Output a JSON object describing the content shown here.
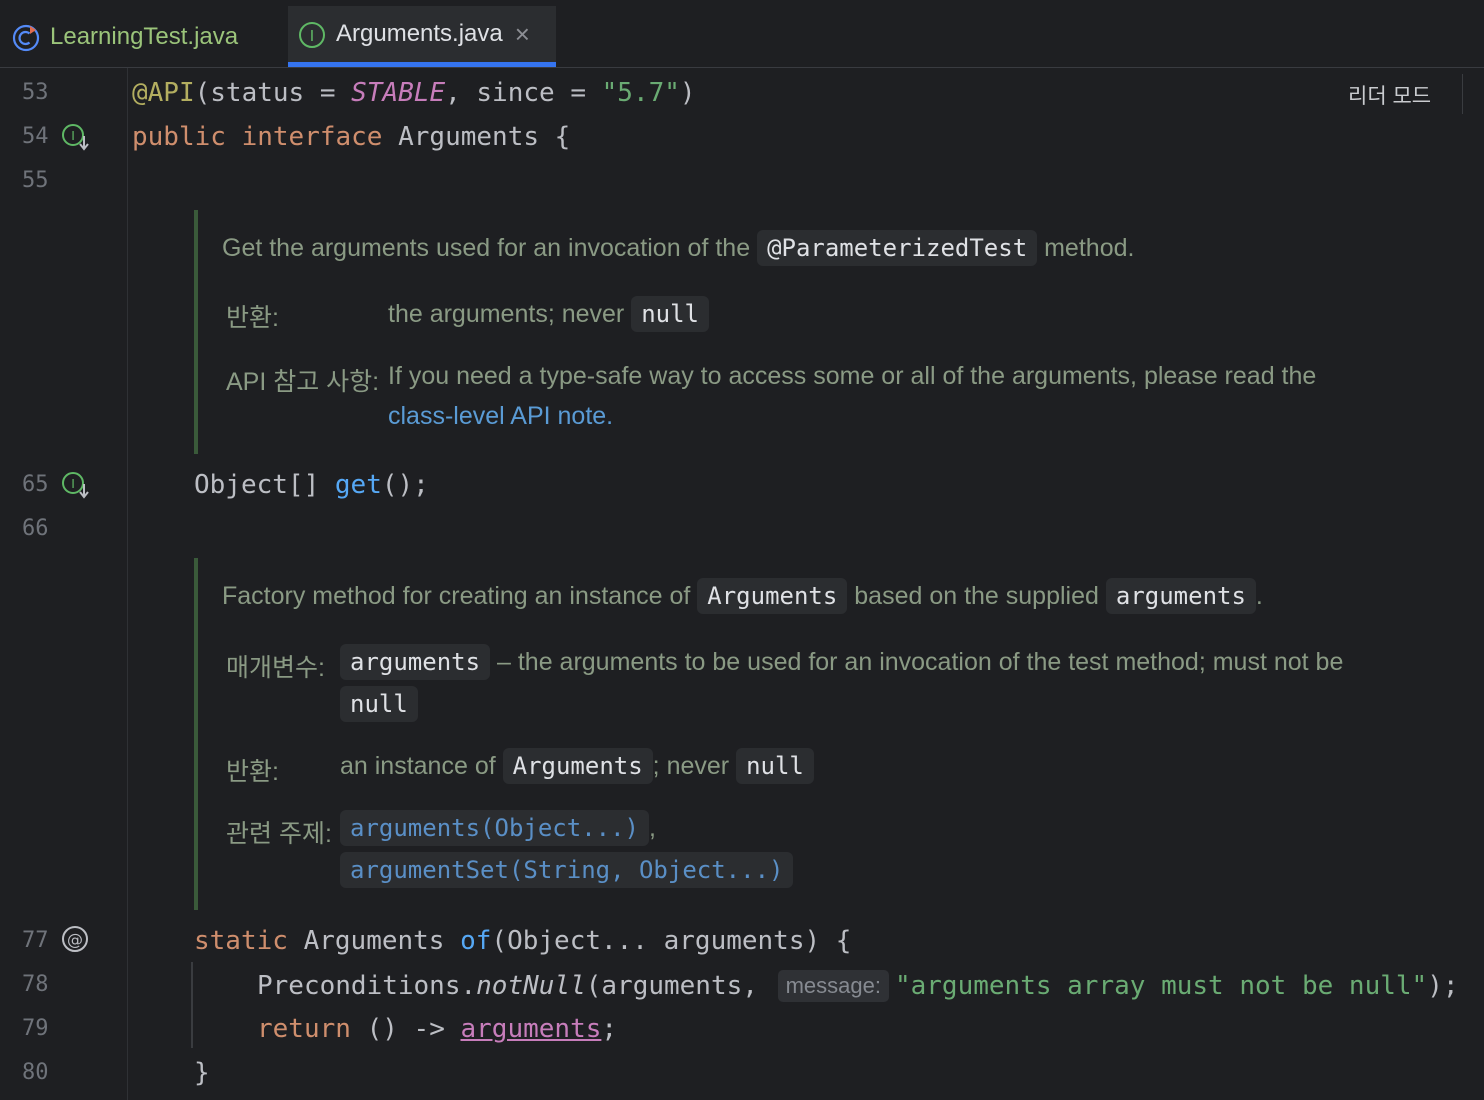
{
  "tabs": [
    {
      "label": "LearningTest.java",
      "icon": "class-run-icon",
      "active": false
    },
    {
      "label": "Arguments.java",
      "icon": "interface-icon",
      "active": true,
      "close": "×"
    }
  ],
  "toolbar": {
    "reader_mode": "리더 모드"
  },
  "gutter": {
    "lines": [
      "53",
      "54",
      "55",
      "65",
      "66",
      "77",
      "78",
      "79",
      "80"
    ]
  },
  "code": {
    "l53": {
      "annotation": "@API",
      "open": "(status = ",
      "const": "STABLE",
      "mid": ", since = ",
      "str": "\"5.7\"",
      "close": ")"
    },
    "l54": {
      "kw1": "public",
      "kw2": "interface",
      "rest": " Arguments {"
    },
    "l65": {
      "type": "Object[] ",
      "fn": "get",
      "rest": "();"
    },
    "l77": {
      "kw": "static",
      "type": " Arguments ",
      "fn": "of",
      "rest": "(Object... arguments) {"
    },
    "l78": {
      "pre": "Preconditions.",
      "call": "notNull",
      "args": "(arguments,",
      "hint": "message:",
      "str": "\"arguments array must not be null\"",
      "end": ");"
    },
    "l79": {
      "kw": "return",
      "mid": " () -> ",
      "var": "arguments",
      "end": ";"
    },
    "l80": {
      "text": "}"
    }
  },
  "doc1": {
    "desc_pre": "Get the arguments used for an invocation of the",
    "desc_code": "@ParameterizedTest",
    "desc_post": "method.",
    "returns_label": "반환:",
    "returns_text": "the arguments; never",
    "returns_code": "null",
    "apinote_label": "API 참고 사항:",
    "apinote_text": "If you need a type-safe way to access some or all of the arguments, please read the",
    "apinote_link": "class-level API note",
    "apinote_end": "."
  },
  "doc2": {
    "desc_pre": "Factory method for creating an instance of",
    "desc_code1": "Arguments",
    "desc_mid": "based on the supplied",
    "desc_code2": "arguments",
    "desc_end": ".",
    "params_label": "매개변수:",
    "param_code": "arguments",
    "param_text": "– the arguments to be used for an invocation of the test method; must not be",
    "param_code2": "null",
    "returns_label": "반환:",
    "returns_pre": "an instance of",
    "returns_code": "Arguments",
    "returns_mid": "; never",
    "returns_code2": "null",
    "see_label": "관련 주제:",
    "see_link1": "arguments(Object...)",
    "see_sep": ",",
    "see_link2": "argumentSet(String, Object...)"
  }
}
